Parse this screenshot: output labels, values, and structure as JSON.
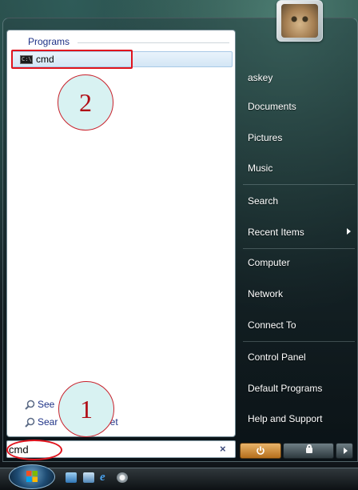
{
  "menu": {
    "programs_heading": "Programs",
    "program_item": {
      "label": "cmd",
      "icon": "command-prompt-icon"
    },
    "search_links": [
      {
        "label": "See",
        "icon": "search-icon"
      },
      {
        "label": "Sear",
        "label_tail": "net",
        "icon": "search-icon"
      }
    ],
    "search_box": {
      "value": "cmd",
      "clear_label": "×"
    }
  },
  "right_pane": {
    "items": [
      {
        "label": "askey"
      },
      {
        "label": "Documents"
      },
      {
        "label": "Pictures"
      },
      {
        "label": "Music"
      },
      {
        "label": "Search"
      },
      {
        "label": "Recent Items",
        "has_submenu": true
      },
      {
        "label": "Computer"
      },
      {
        "label": "Network"
      },
      {
        "label": "Connect To"
      },
      {
        "label": "Control Panel"
      },
      {
        "label": "Default Programs"
      },
      {
        "label": "Help and Support"
      }
    ]
  },
  "annotations": {
    "callout_1": "1",
    "callout_2": "2",
    "highlight_color": "#e0141e"
  },
  "buttons": {
    "power_icon": "power-icon",
    "lock_icon": "lock-icon",
    "more_icon": "arrow-right-icon"
  },
  "taskbar": {
    "start_icon": "windows-logo-icon",
    "quick_launch": [
      "show-desktop-icon",
      "switch-windows-icon",
      "internet-explorer-icon",
      "media-player-icon"
    ]
  },
  "colors": {
    "link_blue": "#1e3287",
    "pane_white": "#ffffff"
  }
}
